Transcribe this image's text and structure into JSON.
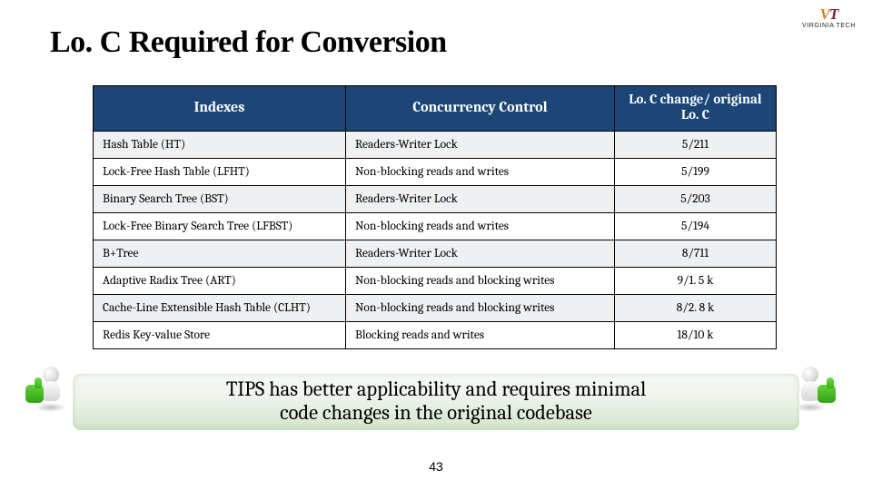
{
  "logo": {
    "initials_a": "V",
    "initials_b": "T",
    "subtext": "VIRGINIA TECH"
  },
  "title": "Lo. C Required for Conversion",
  "table": {
    "headers": {
      "col1": "Indexes",
      "col2": "Concurrency Control",
      "col3": "Lo. C  change/ original Lo. C"
    },
    "rows": [
      {
        "c1": "Hash Table (HT)",
        "c2": "Readers-Writer Lock",
        "c3": "5/211"
      },
      {
        "c1": "Lock-Free Hash Table (LFHT)",
        "c2": "Non-blocking reads and writes",
        "c3": "5/199"
      },
      {
        "c1": "Binary Search Tree (BST)",
        "c2": "Readers-Writer Lock",
        "c3": "5/203"
      },
      {
        "c1": "Lock-Free Binary Search Tree (LFBST)",
        "c2": "Non-blocking reads and writes",
        "c3": "5/194"
      },
      {
        "c1": "B+Tree",
        "c2": "Readers-Writer Lock",
        "c3": "8/711"
      },
      {
        "c1": "Adaptive Radix Tree (ART)",
        "c2": "Non-blocking reads and blocking writes",
        "c3": "9/1. 5 k"
      },
      {
        "c1": "Cache-Line Extensible Hash Table (CLHT)",
        "c2": "Non-blocking reads and blocking writes",
        "c3": "8/2. 8 k"
      },
      {
        "c1": "Redis Key-value Store",
        "c2": "Blocking reads and writes",
        "c3": "18/10 k"
      }
    ]
  },
  "banner": {
    "line1": "TIPS has better applicability and requires minimal",
    "line2": "code changes in the original codebase"
  },
  "page_number": "43"
}
